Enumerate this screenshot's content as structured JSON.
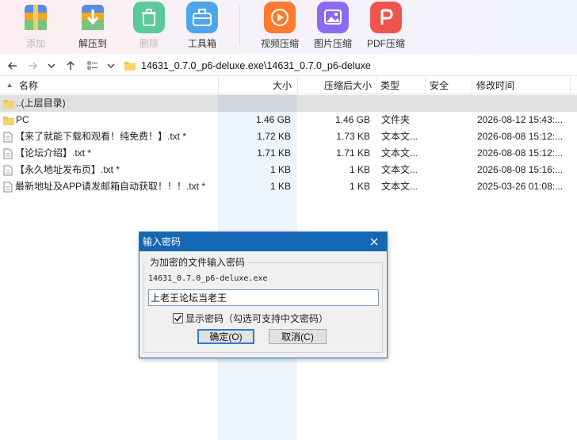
{
  "toolbar": {
    "items": [
      {
        "label": "添加",
        "icon": "add-archive-icon",
        "enabled": false
      },
      {
        "label": "解压到",
        "icon": "extract-icon",
        "enabled": true
      },
      {
        "label": "删除",
        "icon": "delete-icon",
        "enabled": false
      },
      {
        "label": "工具箱",
        "icon": "toolbox-icon",
        "enabled": true
      },
      {
        "label": "视频压缩",
        "icon": "video-compress-icon",
        "enabled": true
      },
      {
        "label": "图片压缩",
        "icon": "image-compress-icon",
        "enabled": true
      },
      {
        "label": "PDF压缩",
        "icon": "pdf-compress-icon",
        "enabled": true
      }
    ]
  },
  "address": {
    "path": "14631_0.7.0_p6-deluxe.exe\\14631_0.7.0_p6-deluxe"
  },
  "columns": {
    "name": "名称",
    "size": "大小",
    "packed": "压缩后大小",
    "type": "类型",
    "security": "安全",
    "modified": "修改时间"
  },
  "rows": [
    {
      "name": "..(上层目录)",
      "size": "",
      "packed": "",
      "type": "",
      "modified": "",
      "kind": "folder",
      "selected": true
    },
    {
      "name": "PC",
      "size": "1.46 GB",
      "packed": "1.46 GB",
      "type": "文件夹",
      "modified": "2026-08-12 15:43:...",
      "kind": "folder",
      "selected": false
    },
    {
      "name": "【来了就能下载和观看！纯免费！】.txt *",
      "size": "1.72 KB",
      "packed": "1.73 KB",
      "type": "文本文...",
      "modified": "2026-08-08 15:12:...",
      "kind": "file",
      "selected": false
    },
    {
      "name": "【论坛介绍】.txt *",
      "size": "1.71 KB",
      "packed": "1.71 KB",
      "type": "文本文...",
      "modified": "2026-08-08 15:12:...",
      "kind": "file",
      "selected": false
    },
    {
      "name": "【永久地址发布页】.txt *",
      "size": "1 KB",
      "packed": "1 KB",
      "type": "文本文...",
      "modified": "2026-08-08 15:16:...",
      "kind": "file",
      "selected": false
    },
    {
      "name": "最新地址及APP请发邮箱自动获取！！！.txt *",
      "size": "1 KB",
      "packed": "1 KB",
      "type": "文本文...",
      "modified": "2025-03-26 01:08:...",
      "kind": "file",
      "selected": false
    }
  ],
  "dialog": {
    "title": "输入密码",
    "group_label": "为加密的文件输入密码",
    "filename": "14631_0.7.0_p6-deluxe.exe",
    "password_value": "上老王论坛当老王",
    "show_password_label": "显示密码（勾选可支持中文密码）",
    "show_password_checked": true,
    "ok_label": "确定(O)",
    "cancel_label": "取消(C)"
  },
  "colors": {
    "accent": "#1567b3",
    "folder": "#f3c14b"
  }
}
